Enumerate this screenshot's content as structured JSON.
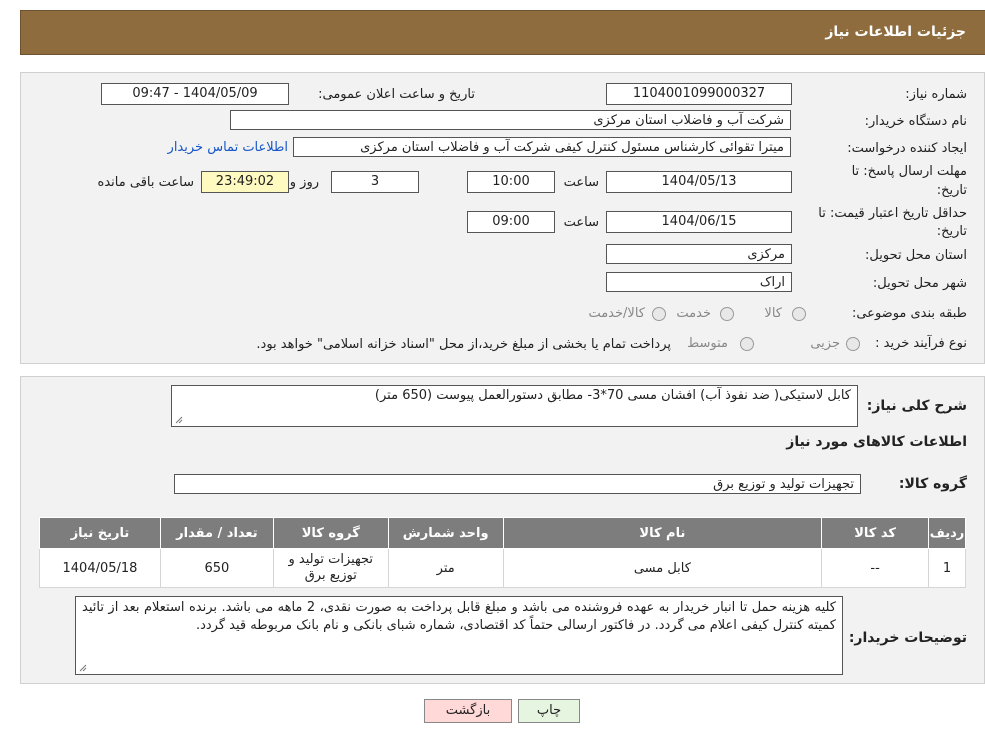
{
  "header": {
    "title": "جزئیات اطلاعات نیاز"
  },
  "details": {
    "need_number_label": "شماره نیاز:",
    "need_number": "1104001099000327",
    "announce_label": "تاریخ و ساعت اعلان عمومی:",
    "announce_value": "1404/05/09 - 09:47",
    "buyer_org_label": "نام دستگاه خریدار:",
    "buyer_org": "شرکت آب و فاضلاب استان مرکزی",
    "creator_label": "ایجاد کننده درخواست:",
    "creator": "میترا تقوائی کارشناس مسئول کنترل کیفی شرکت آب و فاضلاب استان مرکزی",
    "contact_link": "اطلاعات تماس خریدار",
    "deadline_label_1": "مهلت ارسال پاسخ: تا",
    "deadline_label_2": "تاریخ:",
    "deadline_date": "1404/05/13",
    "time_label": "ساعت",
    "deadline_time": "10:00",
    "days": "3",
    "days_label": "روز و",
    "remaining_time": "23:49:02",
    "remaining_label": "ساعت باقی مانده",
    "validity_label_1": "حداقل تاریخ اعتبار قیمت: تا",
    "validity_label_2": "تاریخ:",
    "validity_date": "1404/06/15",
    "validity_time": "09:00",
    "province_label": "استان محل تحویل:",
    "province": "مرکزی",
    "city_label": "شهر محل تحویل:",
    "city": "اراک",
    "category_label": "طبقه بندی موضوعی:",
    "category_options": [
      "کالا",
      "خدمت",
      "کالا/خدمت"
    ],
    "process_label": "نوع فرآیند خرید :",
    "process_options": [
      "جزیی",
      "متوسط"
    ],
    "process_note": "پرداخت تمام یا بخشی از مبلغ خرید،از محل \"اسناد خزانه اسلامی\" خواهد بود."
  },
  "summary": {
    "label": "شرح کلی نیاز:",
    "text": "کابل لاستیکی( ضد نفوذ آب) افشان مسی 70*3- مطابق دستورالعمل پیوست (650 متر)",
    "goods_info_title": "اطلاعات کالاهای مورد نیاز",
    "group_label": "گروه کالا:",
    "group_value": "تجهیزات تولید و توزیع برق"
  },
  "table": {
    "headers": [
      "ردیف",
      "کد کالا",
      "نام کالا",
      "واحد شمارش",
      "گروه کالا",
      "تعداد / مقدار",
      "تاریخ نیاز"
    ],
    "rows": [
      [
        "1",
        "--",
        "کابل مسی",
        "متر",
        "تجهیزات تولید و توزیع برق",
        "650",
        "1404/05/18"
      ]
    ]
  },
  "notes": {
    "label": "توضیحات خریدار:",
    "text": "کلیه هزینه حمل تا انبار خریدار به عهده فروشنده می باشد و مبلغ قابل پرداخت به صورت نقدی، 2 ماهه می باشد. برنده استعلام بعد از تائید کمیته کنترل کیفی اعلام می گردد. در فاکتور ارسالی حتماً کد اقتصادی، شماره شبای بانکی و نام بانک مربوطه قید گردد."
  },
  "buttons": {
    "print": "چاپ",
    "back": "بازگشت"
  },
  "colors": {
    "header_bg": "#8e6c3e",
    "link": "#1756c8",
    "back_bg": "#ffd8d8",
    "print_bg": "#e6f5e0"
  }
}
